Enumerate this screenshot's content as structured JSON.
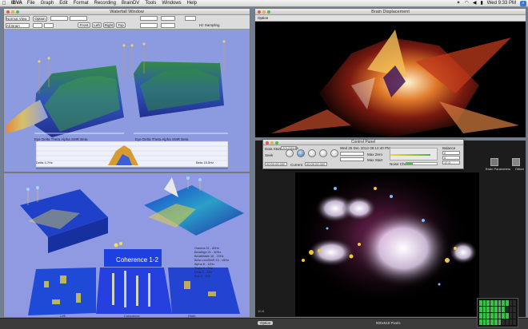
{
  "menubar": {
    "app": "IBVA",
    "items": [
      "File",
      "Graph",
      "Edit",
      "Format",
      "Recording",
      "BrainDV",
      "Tools",
      "Windows",
      "Help"
    ],
    "clock": "Wed 9:33 PM"
  },
  "waterfall": {
    "title": "Waterfall Window",
    "view_select": "Normal View",
    "option_label": "Option",
    "channel_select": "All Brain",
    "front_label": "Front",
    "left_label": "Left",
    "right_label": "Right",
    "top_label": "Top",
    "rate_label": "Hz Sampling",
    "left_title": "Eye Delta Theta Alpha SMR Beta",
    "right_title": "Eye Delta Theta Alpha SMR Beta",
    "bottom_caption": "Delta 4.7Hz",
    "bottom_caption2": "Beta 15.5Hz"
  },
  "brain": {
    "title": "Brain Displacement",
    "option_label": "Option"
  },
  "coherence": {
    "label": "Coherence 1-2",
    "legend": [
      "Gamma 31 - 60Hz",
      "BetaHigh 21 - 30Hz",
      "BetaMiddle 18 - 20Hz",
      "Beta Low/SMR 13 - 15Hz",
      "Alpha 8 - 12Hz",
      "Theta 4 - 7Hz",
      "Delta 1 - 3Hz",
      "Eye 0 - 1Hz"
    ],
    "left_axis": "Left",
    "center_axis": "Coherence",
    "right_axis": "Right"
  },
  "control_panel": {
    "title": "Control Panel",
    "date_label": "Wed 25 Dec 2012 09:12:40 PM",
    "start_label": "Data Start",
    "date_start": "2012/09/19",
    "seek_label": "Seek",
    "current_label": "Current",
    "current_time": "00:00:00.000",
    "time_field": "00:00:00.000",
    "max_start": "Max Start",
    "max_zero": "Max Zero",
    "balance_label": "Balance",
    "noise_label": "Noise Check",
    "vals": [
      "0",
      "0",
      "17.0"
    ]
  },
  "particles": {
    "left_label": "10-8",
    "size_label": "900x518 Pixels",
    "option_label": "Option"
  },
  "side_panel": {
    "label": "Brain Parameters",
    "btn": "Dither"
  },
  "colors": {
    "accent": "#3478d8",
    "meter_on": "#3bbf4a"
  }
}
